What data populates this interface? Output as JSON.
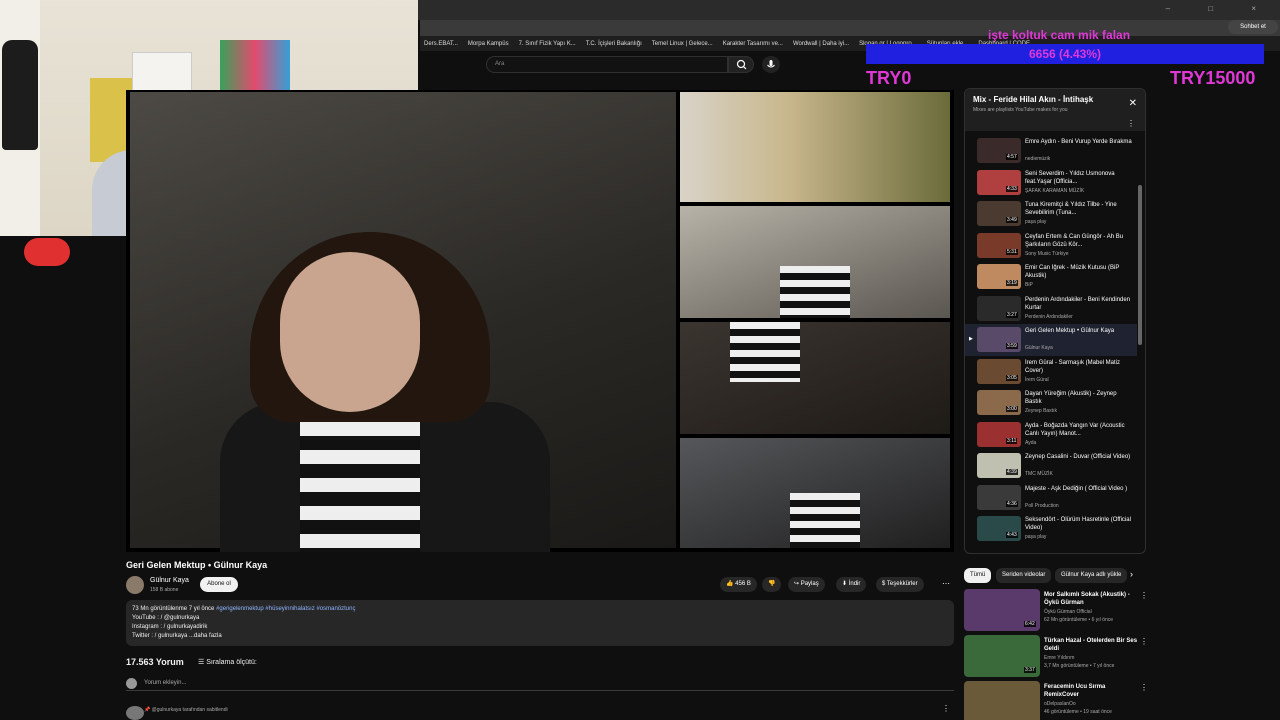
{
  "browser": {
    "bookmarks": [
      "Ders.EBAT...",
      "Morpa Kampüs",
      "7. Sınıf Fizik Yapı K...",
      "T.C. İçişleri Bakanlığı",
      "Temel Linux | Gelece...",
      "Karakter Tasarımı ve...",
      "Wordwall | Daha iyi...",
      "Slogan.gr | Logopro...",
      "Sütunları ekle...",
      "Dashboard | CODE"
    ],
    "chat_label": "Sohbet et"
  },
  "overlay": {
    "title": "işte koltuk cam mik falan",
    "progress_label": "6656 (4.43%)",
    "progress_fraction": 0.0443,
    "left_amount": "TRY0",
    "right_amount": "TRY15000",
    "color": "#e038d6",
    "bar_color": "#2020e0"
  },
  "search": {
    "placeholder": "Ara"
  },
  "video": {
    "title": "Geri Gelen Mektup • Gülnur Kaya",
    "channel": "Gülnur Kaya",
    "subscribers": "158 B abone",
    "subscribe_label": "Abone ol",
    "likes": "456 B",
    "share_label": "Paylaş",
    "download_label": "İndir",
    "thanks_label": "Teşekkürler",
    "description": {
      "views_line": "73 Mn görüntülenme  7 yıl önce",
      "tags": "#gerigelenmektup #hüseyinnihalatsız #osmanöztunç",
      "youtube_line": "YouTube : / @gulnurkaya",
      "instagram_line": "Instagram : / gulnurkayadirik",
      "twitter_line": "Twitter : / gulnurkaya ...daha fazla"
    },
    "comments_count": "17.563 Yorum",
    "sort_label": "Sıralama ölçütü:",
    "add_comment_placeholder": "Yorum ekleyin...",
    "pinned_label": "@gulnurkaya tarafından sabitlendi"
  },
  "playlist": {
    "title": "Mix - Feride Hilal Akın - İntihaşk",
    "subtitle": "Mixes are playlists YouTube makes for you",
    "items": [
      {
        "title": "Emre Aydın - Beni Vurup Yerde Bırakma",
        "channel": "nediemüzik",
        "duration": "4:57"
      },
      {
        "title": "Seni Severdim - Yıldız Usmonova feat.Yaşar (Officia...",
        "channel": "ŞAFAK KARAMAN MÜZİK",
        "duration": "4:33"
      },
      {
        "title": "Tuna Kiremitçi & Yıldız Tilbe - Yine Sevebilirim (Tuna...",
        "channel": "paşa play",
        "duration": "3:49"
      },
      {
        "title": "Ceyfan Ertem & Can Güngör - Ah Bu Şarkıların Gözü Kör...",
        "channel": "Sony Music Türkiye",
        "duration": "5:31"
      },
      {
        "title": "Emir Can İğrek - Müzik Kutusu (BiP Akustik)",
        "channel": "BiP",
        "duration": "3:19"
      },
      {
        "title": "Perdenin Ardındakiler - Beni Kendinden Kurtar",
        "channel": "Perdenin Ardındakiler",
        "duration": "3:27"
      },
      {
        "title": "Geri Gelen Mektup • Gülnur Kaya",
        "channel": "Gülnur Kaya",
        "duration": "3:59",
        "active": true
      },
      {
        "title": "İrem Güral - Sarmaşık (Mabel Matiz Cover)",
        "channel": "İrem Güral",
        "duration": "3:05"
      },
      {
        "title": "Dayan Yüreğim (Akustik) - Zeynep Bastık",
        "channel": "Zeynep Bastık",
        "duration": "3:00"
      },
      {
        "title": "Ayda - Boğazda Yangın Var (Acoustic Canlı Yayın) Manot...",
        "channel": "Ayda",
        "duration": "3:11"
      },
      {
        "title": "Zeynep Casalini - Duvar (Official Video)",
        "channel": "TMC MÜZİK",
        "duration": "4:39"
      },
      {
        "title": "Majeste - Aşk Dediğin ( Official Video )",
        "channel": "Poll Production",
        "duration": "4:36"
      },
      {
        "title": "Seksendört - Ölürüm Hasretinle (Official Video)",
        "channel": "paşa play",
        "duration": "4:43"
      }
    ]
  },
  "chips": [
    "Tümü",
    "Seriden videolar",
    "Gülnur Kaya adlı yükle"
  ],
  "recommendations": [
    {
      "title": "Mor Salkımlı Sokak (Akustik) - Öykü Gürman",
      "channel": "Öykü Gürman Official",
      "meta": "62 Mn görüntüleme • 6 yıl önce",
      "duration": "6:42"
    },
    {
      "title": "Türkan Hazal - Ötelerden Bir Ses Geldi",
      "channel": "Emre Yıldırım",
      "meta": "3,7 Mn görüntüleme • 7 yıl önce",
      "duration": "3:37"
    },
    {
      "title": "Feracemin Ucu Sırma RemixCover",
      "channel": "oDelpaslanOo",
      "meta": "46 görüntüleme • 19 saat önce",
      "duration": ""
    }
  ]
}
